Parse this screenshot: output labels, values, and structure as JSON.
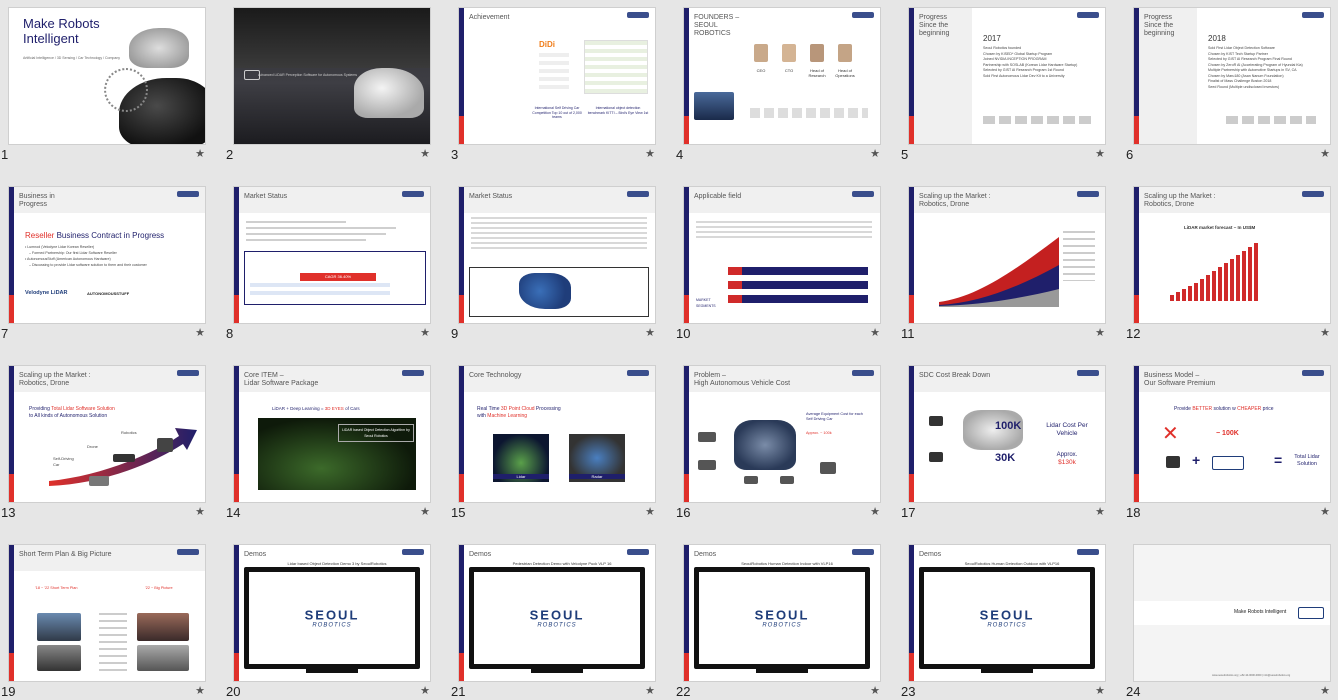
{
  "slides": [
    {
      "num": "1",
      "title_l1": "Make Robots",
      "title_l2": "Intelligent",
      "subtitle": "Artificial Intelligence / 3D Sensing / Car Technology / Company"
    },
    {
      "num": "2",
      "caption": "Advanced LiDAR Perception Software for Autonomous Systems"
    },
    {
      "num": "3",
      "title": "Achievement",
      "logo_text": "DiDi",
      "cap1": "International Self Driving Car Competition Top 10 out of 2,000 teams",
      "cap2": "International object detection benchmark KITTI – Bird's Eye View 1st"
    },
    {
      "num": "4",
      "title": "FOUNDERS – SEOUL ROBOTICS",
      "roles": [
        "CEO",
        "CTO",
        "Head of Research",
        "Head of Operations"
      ]
    },
    {
      "num": "5",
      "title": "Progress Since the beginning",
      "year": "2017",
      "items": [
        "Seoul Robotics founded",
        "Chosen by KISED* Global Startup Program",
        "Joined NVIDIA INCEPTION PROGRAM",
        "Partnership with SOSLAB (Korean Lidar Hardware Startup)",
        "Selected by GIST AI Research Program 1st Round",
        "Sold First Autonomous Lidar Dev Kit to a University"
      ]
    },
    {
      "num": "6",
      "title": "Progress Since the beginning",
      "year": "2018",
      "items": [
        "Sold First Lidar Object Detection Software",
        "Chosen by KIST Tech Startup Partner",
        "Selected by GIST AI Research Program Final Round",
        "Chosen by ZeroR AI (Accelerating Program of Hyundai Kia)",
        "Multiple Partnership with Automotive Startups in SV, CA",
        "Chosen by Maru180 (Asan Nanum Foundation)",
        "Finalist of Mass Challenge Boston 2018",
        "Seed Round (Multiple undisclosed investors)"
      ]
    },
    {
      "num": "7",
      "title": "Business in Progress",
      "headline_red": "Reseller",
      "headline_rest": "Business Contract in Progress",
      "b1": "• Lumnod (Velodyne Lidar Korean Reseller)",
      "b1a": "– Formed Partnership: Our first Lidar Software Reseller",
      "b2": "• AutonomousStuff (American Autonomous Hardware)",
      "b2a": "– Discussing to provide Lidar software solution to them and their customer",
      "logo1": "Velodyne LiDAR",
      "logo2": "AUTONOMOUSSTUFF"
    },
    {
      "num": "8",
      "title": "Market Status",
      "cagr": "CAGR 36.40%"
    },
    {
      "num": "9",
      "title": "Market Status"
    },
    {
      "num": "10",
      "title": "Applicable field",
      "left_label": "MARKET SEGMENTS"
    },
    {
      "num": "11",
      "title_l1": "Scaling up the Market :",
      "title_l2": "Robotics, Drone"
    },
    {
      "num": "12",
      "title_l1": "Scaling up the Market :",
      "title_l2": "Robotics, Drone",
      "chart_title": "LiDAR market forecast – In US$M"
    },
    {
      "num": "13",
      "title_l1": "Scaling up the Market :",
      "title_l2": "Robotics, Drone",
      "line1_pre": "Providing ",
      "line1_red": "Total Lidar Software Solution",
      "line2": "to All kinds of Autonomous Solution",
      "robotics": "Robotics",
      "drone": "Drone",
      "car": "Self-Driving Car"
    },
    {
      "num": "14",
      "title_l1": "Core ITEM –",
      "title_l2": "Lidar Software Package",
      "line_pre": "LiDAR + Deep Learning = ",
      "line_red": "3D EYES",
      "line_post": " of Cars",
      "box": "LiDAR based Object Detection Algorithm by Seoul Robotics"
    },
    {
      "num": "15",
      "title": "Core Technology",
      "line1_pre": "Real Time ",
      "line1_red": "3D Point Cloud",
      "line1_post": " Processing",
      "line2_pre": "with ",
      "line2_red": "Machine Learning",
      "lab1": "Lidar",
      "lab2": "Radar"
    },
    {
      "num": "16",
      "title_l1": "Problem –",
      "title_l2": "High Autonomous Vehicle Cost",
      "note": "Average Equipment Cost for each Self Driving Car",
      "approx": "Approx. ~ 100k"
    },
    {
      "num": "17",
      "title": "SDC Cost Break Down",
      "v1": "100K",
      "v2": "30K",
      "lidar_cost": "Lidar Cost Per Vehicle",
      "approx": "Approx.",
      "amount": "$130k"
    },
    {
      "num": "18",
      "title_l1": "Business Model –",
      "title_l2": "Our Software Premium",
      "head_pre": "Provide ",
      "head_red": "BETTER",
      "head_mid": " solution w ",
      "head_red2": "CHEAPER",
      "head_post": " price",
      "minus": "100K",
      "total": "Total Lidar Solution"
    },
    {
      "num": "19",
      "title": "Short Term Plan & Big Picture",
      "left_head": "'18 ~ '22 Short Term Plan",
      "right_head": "'22 ~ Big Picture"
    },
    {
      "num": "20",
      "title": "Demos",
      "video": "Lidar based Object Detection Demo 3 by SeoulRobotics",
      "logo1": "SEOUL",
      "logo2": "ROBOTICS"
    },
    {
      "num": "21",
      "title": "Demos",
      "video": "Pedestrian Detection Demo with Velodyne Puck VLP 16",
      "logo1": "SEOUL",
      "logo2": "ROBOTICS"
    },
    {
      "num": "22",
      "title": "Demos",
      "video": "SeoulRobotics Human Detection Indoor with VLP16",
      "logo1": "SEOUL",
      "logo2": "ROBOTICS"
    },
    {
      "num": "23",
      "title": "Demos",
      "video": "SeoulRobotics Human Detection Outdoor with VLP16",
      "logo1": "SEOUL",
      "logo2": "ROBOTICS"
    },
    {
      "num": "24",
      "tagline": "Make Robots Intelligent",
      "footer": "www.seoulrobotics.org | +82-10-0000-0000 | info@seoulrobotics.org"
    }
  ],
  "colors": {
    "navy": "#1f1f6b",
    "red": "#e0302a",
    "background": "#e6e6e6"
  }
}
